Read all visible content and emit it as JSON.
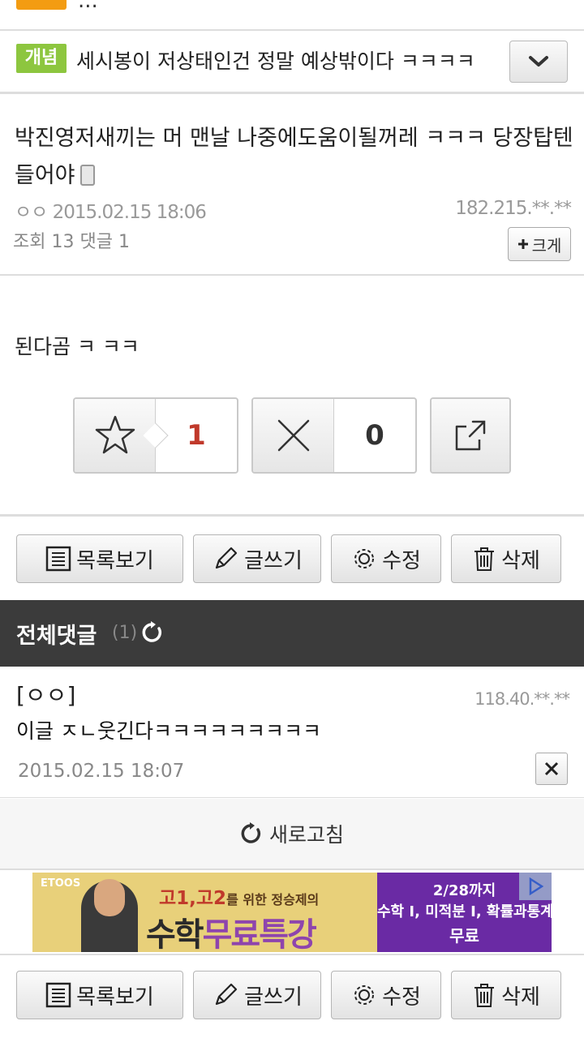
{
  "top_strip": {
    "text": "..."
  },
  "notice": {
    "tag": "개념",
    "title": "세시봉이 저상태인건 정말 예상밖이다 ㅋㅋㅋㅋ"
  },
  "post": {
    "title": "박진영저새끼는 머 맨날 나중에도움이될꺼레 ㅋㅋㅋ 당장탑텐 들어야",
    "author": "ㅇㅇ",
    "datetime": "2015.02.15 18:06",
    "ip": "182.215.**.**",
    "views_label": "조회",
    "views": "13",
    "comments_label": "댓글",
    "comments": "1",
    "bigger_label": "크게",
    "body": "된다곰 ㅋ ㅋㅋ"
  },
  "vote": {
    "recommend_count": "1",
    "dislike_count": "0",
    "recommend_color": "#c0392b"
  },
  "actions": {
    "list": "목록보기",
    "write": "글쓰기",
    "edit": "수정",
    "delete": "삭제"
  },
  "comment_section": {
    "label": "전체댓글",
    "count": "(1)"
  },
  "comments": [
    {
      "author": "[ㅇㅇ]",
      "ip": "118.40.**.**",
      "text": "이글 ㅈㄴ웃긴다ㅋㅋㅋㅋㅋㅋㅋㅋㅋ",
      "datetime": "2015.02.15 18:07"
    }
  ],
  "refresh_label": "새로고침",
  "ad": {
    "brand": "ETOOS",
    "line1_a": "고1,고2",
    "line1_b": "를 위한 정승제의",
    "line2_a": "수학",
    "line2_b": "무료특강",
    "right1": "2/28까지",
    "right2": "수학 I, 미적분 I, 확률과통계",
    "right3": "무료"
  }
}
